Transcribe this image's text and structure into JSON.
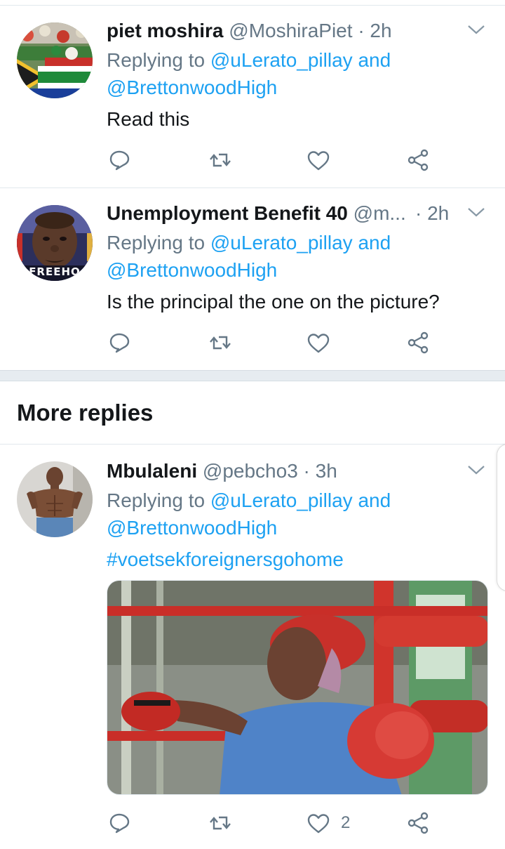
{
  "tweets": [
    {
      "name": "piet moshira",
      "handle": "@MoshiraPiet",
      "time": "· 2h",
      "replying_prefix": "Replying to",
      "reply_user_1": "@uLerato_pillay",
      "reply_and": "and",
      "reply_user_2": "@BrettonwoodHigh",
      "text": "Read this",
      "avatar_icon": "south-african-flag-crowd-avatar",
      "like_count": ""
    },
    {
      "name": "Unemployment Benefit 40",
      "handle": "@m...",
      "time": "· 2h",
      "replying_prefix": "Replying to",
      "reply_user_1": "@uLerato_pillay",
      "reply_and": "and",
      "reply_user_2": "@BrettonwoodHigh",
      "text": "Is the principal the one on the picture?",
      "avatar_icon": "man-portrait-avatar",
      "avatar_caption": "FREEHO",
      "like_count": ""
    },
    {
      "name": "Mbulaleni",
      "handle": "@pebcho3",
      "time": "· 3h",
      "replying_prefix": "Replying to",
      "reply_user_1": "@uLerato_pillay",
      "reply_and": "and",
      "reply_user_2": "@BrettonwoodHigh",
      "text": "#voetsekforeignersgohome",
      "avatar_icon": "shirtless-man-avatar",
      "media": "elderly-woman-boxing-photo",
      "like_count": "2"
    }
  ],
  "section": {
    "more_replies": "More replies"
  },
  "icons": {
    "reply": "reply-icon",
    "retweet": "retweet-icon",
    "like": "heart-icon",
    "share": "share-icon",
    "caret": "chevron-down-icon"
  },
  "colors": {
    "link": "#1da1f2",
    "secondary": "#657786",
    "text": "#14171a",
    "divider": "#e1e8ed"
  }
}
